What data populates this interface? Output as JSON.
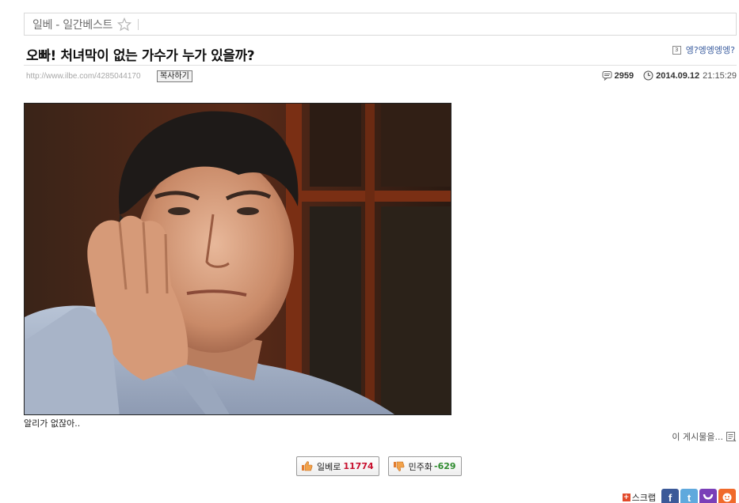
{
  "board": {
    "name": "일베 - 일간베스트"
  },
  "post": {
    "title": "오빠! 처녀막이 없는 가수가 누가 있을까?",
    "author": "엥?엥엥엥엥?",
    "author_level": "3",
    "url": "http://www.ilbe.com/4285044170",
    "copy_label": "복사하기",
    "views": "2959",
    "date": "2014.09.12",
    "time": "21:15:29",
    "caption": "알리가 없잖아..",
    "more_label": "이 게시물을..."
  },
  "votes": {
    "up_label": "일베로",
    "up_count": "11774",
    "down_label": "민주화",
    "down_count": "-629"
  },
  "share": {
    "scrap_label": "스크랩",
    "scrap_icon_glyph": "+",
    "facebook_glyph": "f",
    "twitter_glyph": "t",
    "icons": [
      "facebook-icon",
      "twitter-icon",
      "yozm-icon",
      "me2day-icon"
    ],
    "colors": {
      "facebook": "#3b5998",
      "twitter": "#5fa9dd",
      "yozm": "#7a3fb8",
      "me2day": "#f06a2b"
    }
  },
  "colors": {
    "accent_up": "#c8102e",
    "accent_down": "#2e8b2e",
    "author_link": "#3a5c9e"
  }
}
